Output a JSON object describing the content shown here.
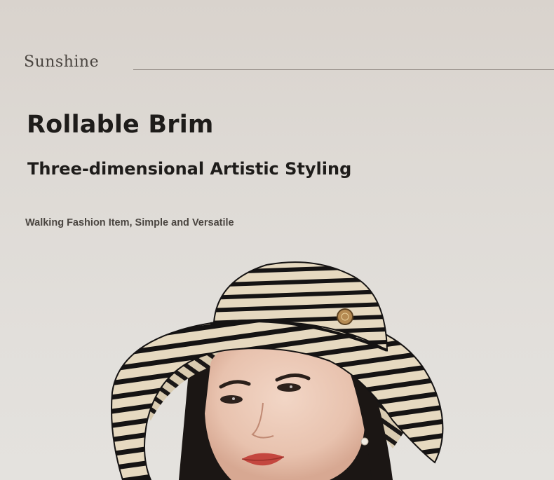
{
  "brand": {
    "name": "Sunshine"
  },
  "hero": {
    "headline": "Rollable Brim",
    "subheadline": "Three-dimensional Artistic Styling",
    "tagline": "Walking Fashion Item, Simple and Versatile"
  },
  "photo": {
    "subject": "model-in-striped-bucket-hat"
  },
  "colors": {
    "background": "#dcd7d2",
    "text_dark": "#1e1c1a",
    "text_muted": "#4a4540",
    "hat_stripe_dark": "#151313",
    "hat_stripe_light": "#e6d9c0"
  }
}
